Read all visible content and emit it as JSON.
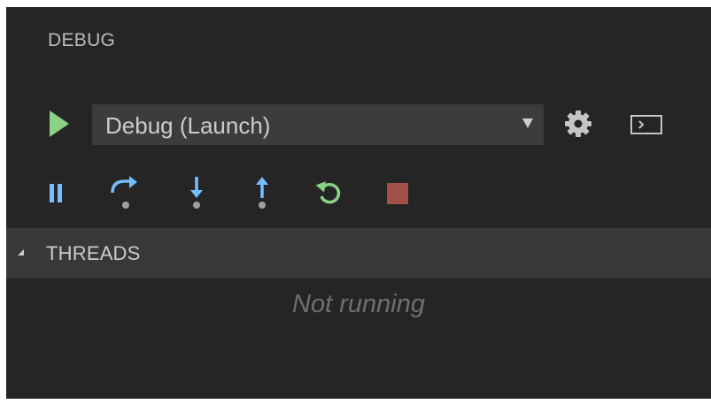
{
  "panel": {
    "title": "DEBUG"
  },
  "launch": {
    "start_icon": "play-icon",
    "configuration_selected": "Debug (Launch)",
    "settings_icon": "gear-icon",
    "console_icon": "terminal-icon"
  },
  "toolbar": {
    "buttons": [
      {
        "icon": "pause-icon"
      },
      {
        "icon": "step-over-icon"
      },
      {
        "icon": "step-into-icon"
      },
      {
        "icon": "step-out-icon"
      },
      {
        "icon": "restart-icon"
      },
      {
        "icon": "stop-icon"
      }
    ]
  },
  "threads": {
    "header": "THREADS",
    "expanded": true,
    "status": "Not running"
  },
  "colors": {
    "panel_bg": "#252526",
    "section_header_bg": "#383838",
    "dropdown_bg": "#3c3c3c",
    "play_green": "#89d185",
    "debug_blue": "#75beff",
    "restart_green": "#89d185",
    "stop_red": "#a1260d"
  }
}
